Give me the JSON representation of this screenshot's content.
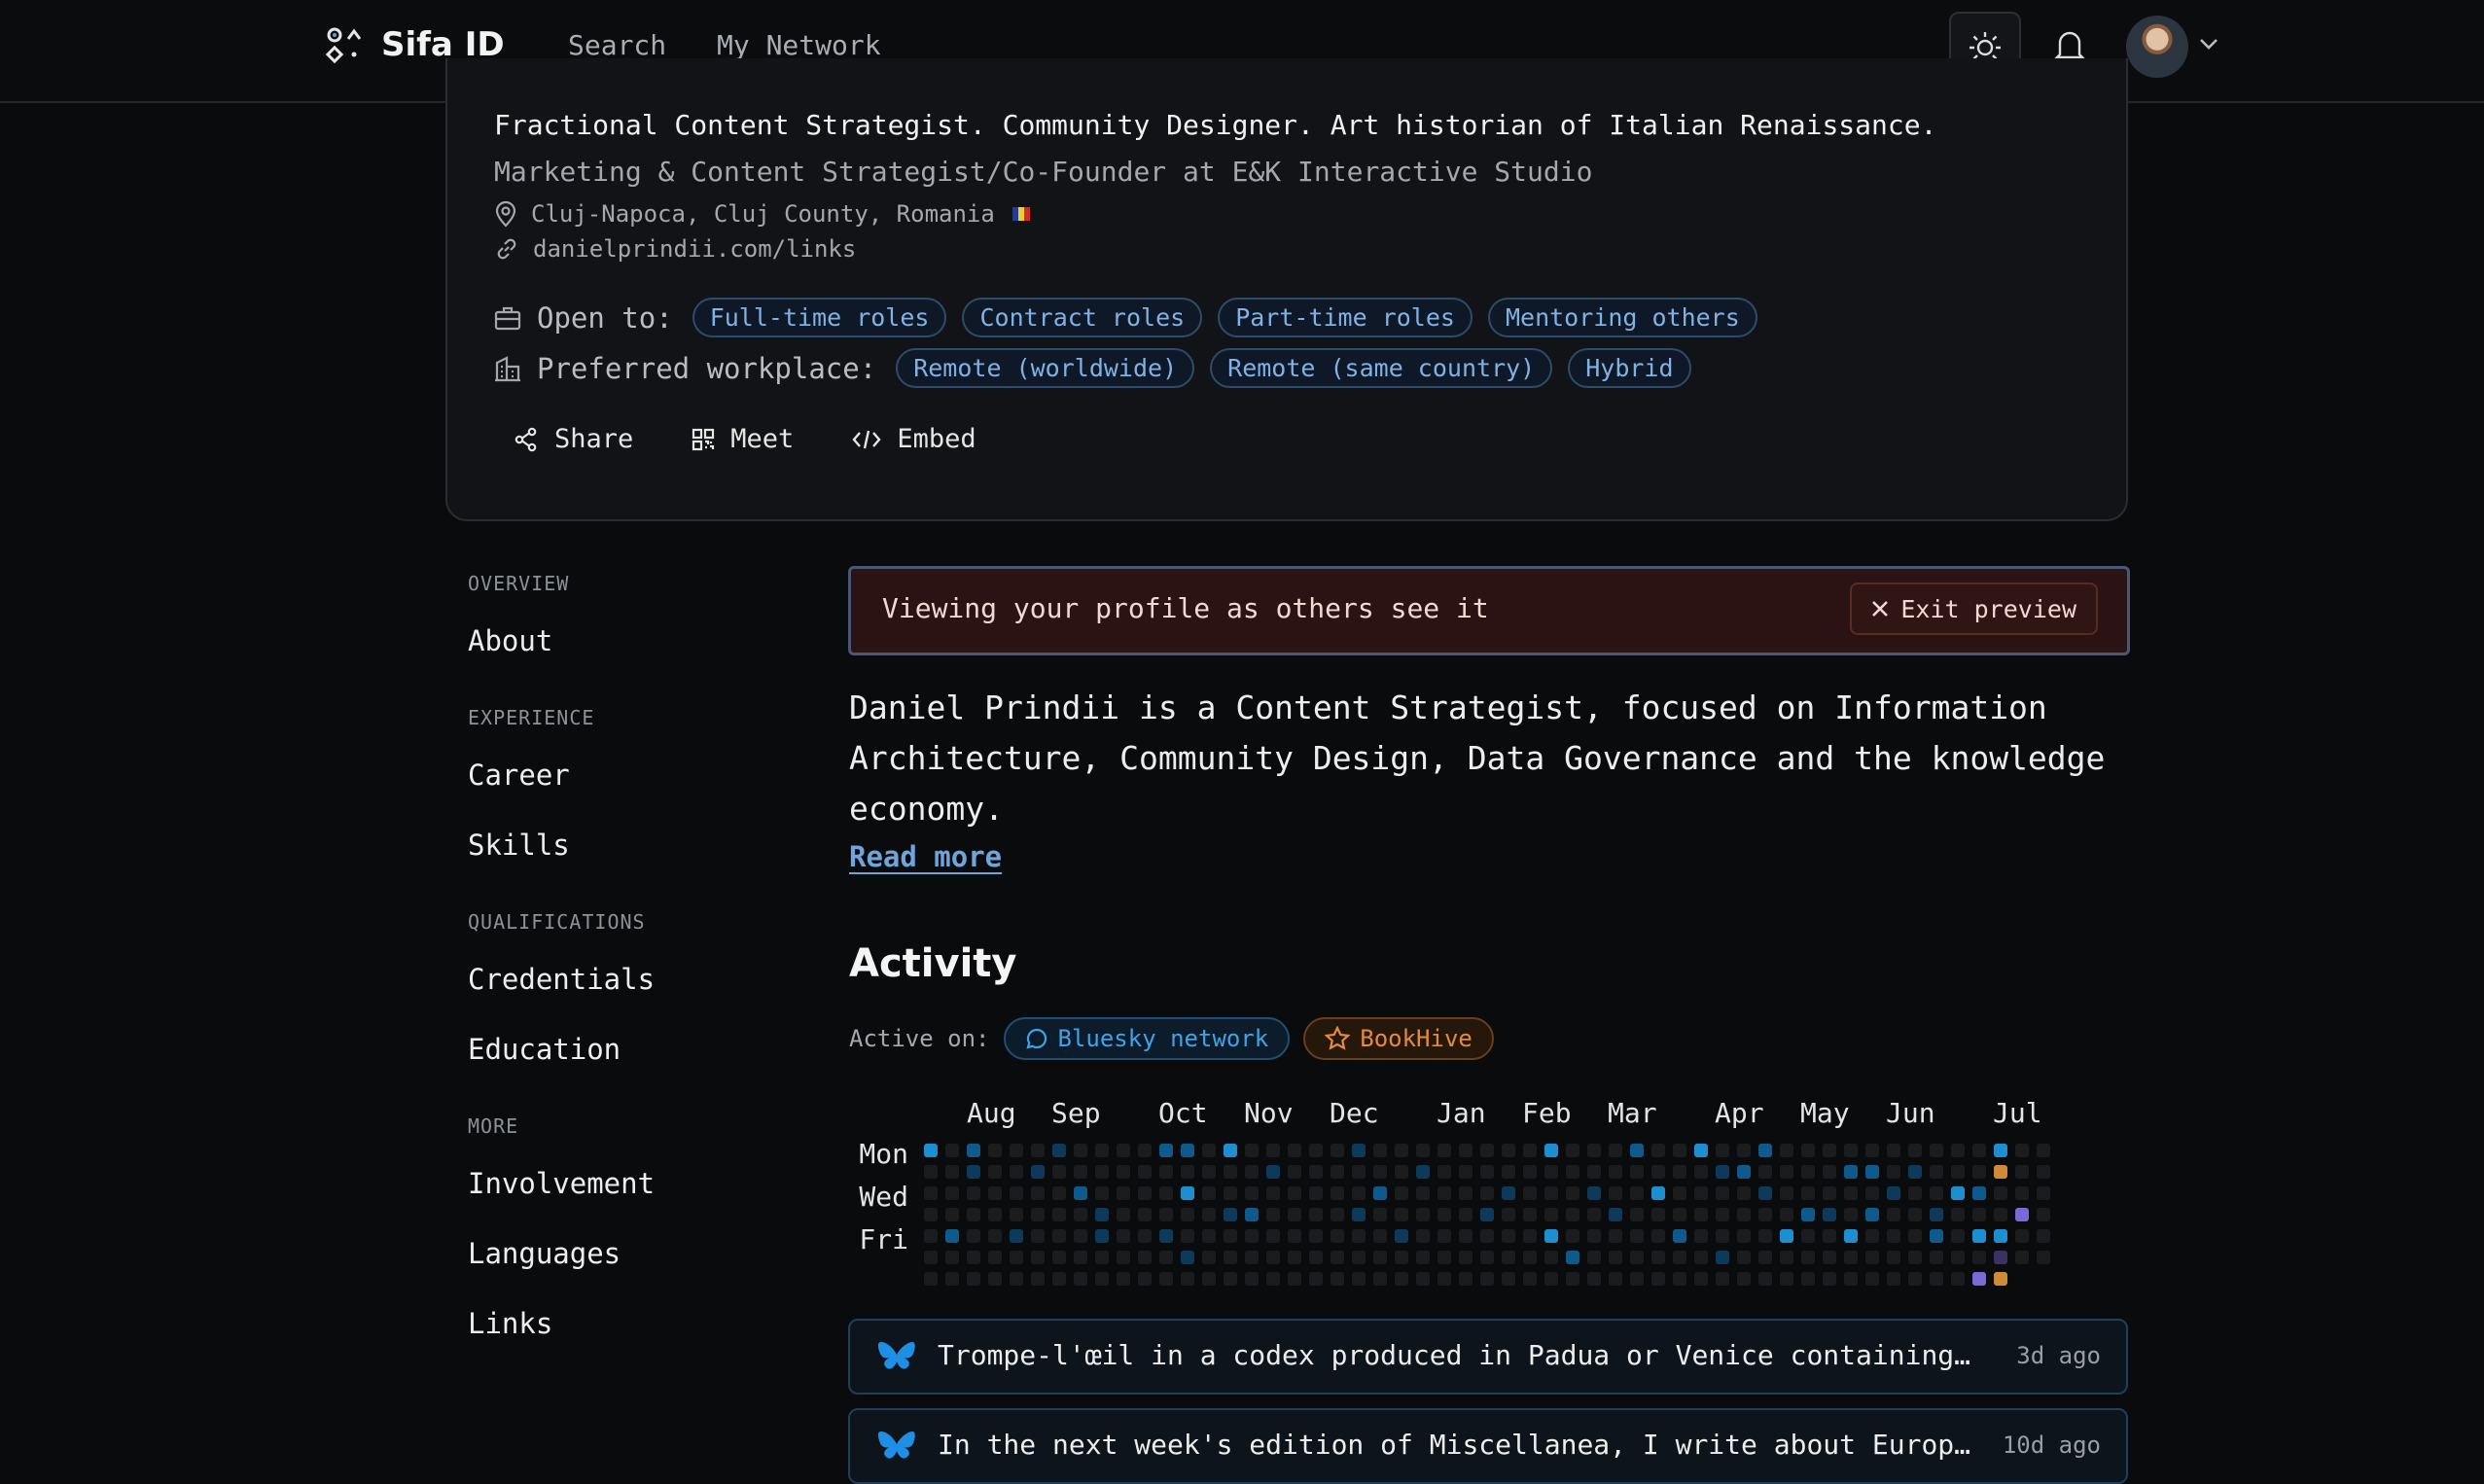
{
  "nav": {
    "brand": "Sifa ID",
    "links": [
      "Search",
      "My Network"
    ]
  },
  "profile": {
    "tagline": "Fractional Content Strategist. Community Designer. Art historian of Italian Renaissance.",
    "role": "Marketing & Content Strategist/Co-Founder at E&K Interactive Studio",
    "location": "Cluj-Napoca, Cluj County, Romania",
    "website": "danielprindii.com/links",
    "open_to_label": "Open to:",
    "open_to": [
      "Full-time roles",
      "Contract roles",
      "Part-time roles",
      "Mentoring others"
    ],
    "workplace_label": "Preferred workplace:",
    "workplace": [
      "Remote (worldwide)",
      "Remote (same country)",
      "Hybrid"
    ],
    "actions": [
      "Share",
      "Meet",
      "Embed"
    ]
  },
  "sidebar": {
    "groups": [
      {
        "heading": "OVERVIEW",
        "items": [
          "About"
        ]
      },
      {
        "heading": "EXPERIENCE",
        "items": [
          "Career",
          "Skills"
        ]
      },
      {
        "heading": "QUALIFICATIONS",
        "items": [
          "Credentials",
          "Education"
        ]
      },
      {
        "heading": "MORE",
        "items": [
          "Involvement",
          "Languages",
          "Links"
        ]
      }
    ]
  },
  "preview": {
    "text": "Viewing your profile as others see it",
    "exit_label": "Exit preview"
  },
  "about": {
    "bio": "Daniel Prindii is a Content Strategist, focused on Information Architecture, Community Design, Data Governance and the knowledge economy.",
    "read_more": "Read more"
  },
  "activity": {
    "title": "Activity",
    "active_on_label": "Active on:",
    "networks": [
      "Bluesky network",
      "BookHive"
    ],
    "months": [
      "Aug",
      "Sep",
      "Oct",
      "Nov",
      "Dec",
      "Jan",
      "Feb",
      "Mar",
      "Apr",
      "May",
      "Jun",
      "Jul"
    ],
    "days": [
      "Mon",
      "Wed",
      "Fri"
    ],
    "colors": {
      "empty": "#1a1c20",
      "blue": "#1d8fd0",
      "orange": "#d08a3a",
      "purple": "#7a6ad6"
    },
    "feed": [
      {
        "text": "Trompe-l'œil in a codex produced in Padua or Venice containing St. Jer...",
        "time": "3d ago"
      },
      {
        "text": "In the next week's edition of Miscellanea, I write about European soci...",
        "time": "10d ago"
      }
    ]
  }
}
